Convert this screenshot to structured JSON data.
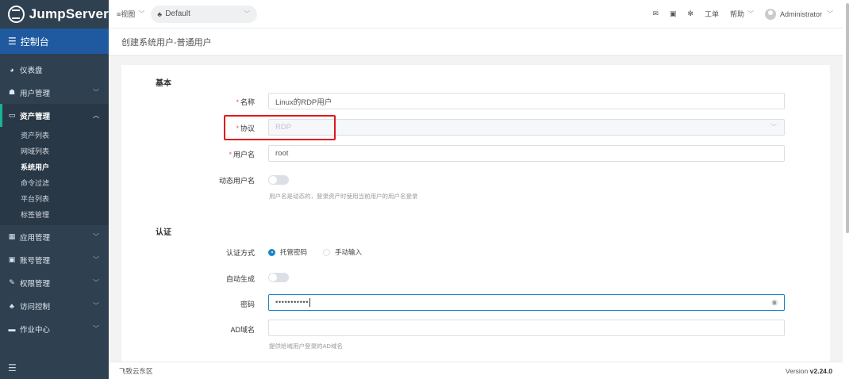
{
  "app": {
    "brand": "JumpServer"
  },
  "sidebar": {
    "console_label": "控制台",
    "items": [
      {
        "label": "仪表盘",
        "icon": "dashboard-icon",
        "has_children": false
      },
      {
        "label": "用户管理",
        "icon": "users-icon",
        "has_children": true
      },
      {
        "label": "资产管理",
        "icon": "inbox-icon",
        "has_children": true,
        "open": true,
        "children": [
          "资产列表",
          "网域列表",
          "系统用户",
          "命令过滤",
          "平台列表",
          "标签管理"
        ],
        "active_child": "系统用户"
      },
      {
        "label": "应用管理",
        "icon": "grid-icon",
        "has_children": true
      },
      {
        "label": "账号管理",
        "icon": "account-icon",
        "has_children": true
      },
      {
        "label": "权限管理",
        "icon": "edit-icon",
        "has_children": true
      },
      {
        "label": "访问控制",
        "icon": "sitemap-icon",
        "has_children": true
      },
      {
        "label": "作业中心",
        "icon": "task-icon",
        "has_children": true
      }
    ]
  },
  "topbar": {
    "view_label": "视图",
    "org_label": "Default",
    "ticket_label": "工单",
    "help_label": "帮助",
    "user_label": "Administrator"
  },
  "page": {
    "title": "创建系统用户-普通用户"
  },
  "form": {
    "section_basic": "基本",
    "name_label": "名称",
    "name_value": "Linux的RDP用户",
    "protocol_label": "协议",
    "protocol_value": "RDP",
    "username_label": "用户名",
    "username_value": "root",
    "dynamic_label": "动态用户名",
    "dynamic_help": "用户名是动态的，登录资产时使用当前用户的用户名登录",
    "section_auth": "认证",
    "auth_method_label": "认证方式",
    "auth_options": [
      "托管密码",
      "手动输入"
    ],
    "auth_selected": "托管密码",
    "auto_gen_label": "自动生成",
    "password_label": "密码",
    "password_value": "•••••••••••",
    "ad_label": "AD域名",
    "ad_value": "",
    "ad_help": "提供给域用户登录的AD域名"
  },
  "footer": {
    "left": "飞致云东区",
    "version_prefix": "Version ",
    "version": "v2.24.0"
  },
  "colors": {
    "sidebar_bg": "#2f4050",
    "console_bg": "#1f5aa0",
    "accent": "#1c84c6",
    "highlight": "#e0181b",
    "required": "#ed5565"
  }
}
